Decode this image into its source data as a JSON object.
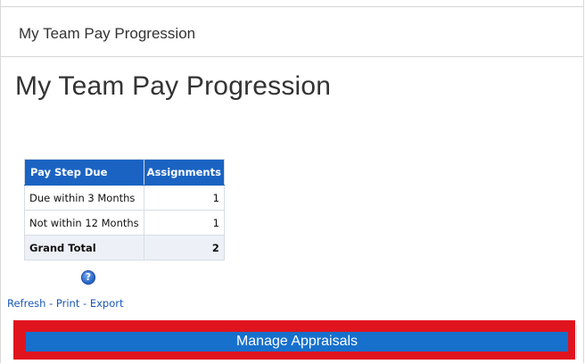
{
  "panel": {
    "header_title": "My Team Pay Progression"
  },
  "page": {
    "title": "My Team Pay Progression"
  },
  "report_table": {
    "columns": [
      "Pay Step Due",
      "Assignments"
    ],
    "rows": [
      {
        "label": "Due within 3 Months",
        "value": "1"
      },
      {
        "label": "Not within 12 Months",
        "value": "1"
      }
    ],
    "total": {
      "label": "Grand Total",
      "value": "2"
    }
  },
  "help": {
    "icon": "help-icon",
    "glyph": "?"
  },
  "report_links": {
    "refresh": "Refresh",
    "print": "Print",
    "export": "Export",
    "separator": "-"
  },
  "actions": {
    "manage_appraisals": "Manage Appraisals"
  },
  "colors": {
    "table_header_bg": "#1a63c2",
    "button_bg": "#1670cc",
    "highlight": "#e0141f",
    "link": "#1a56b8"
  }
}
